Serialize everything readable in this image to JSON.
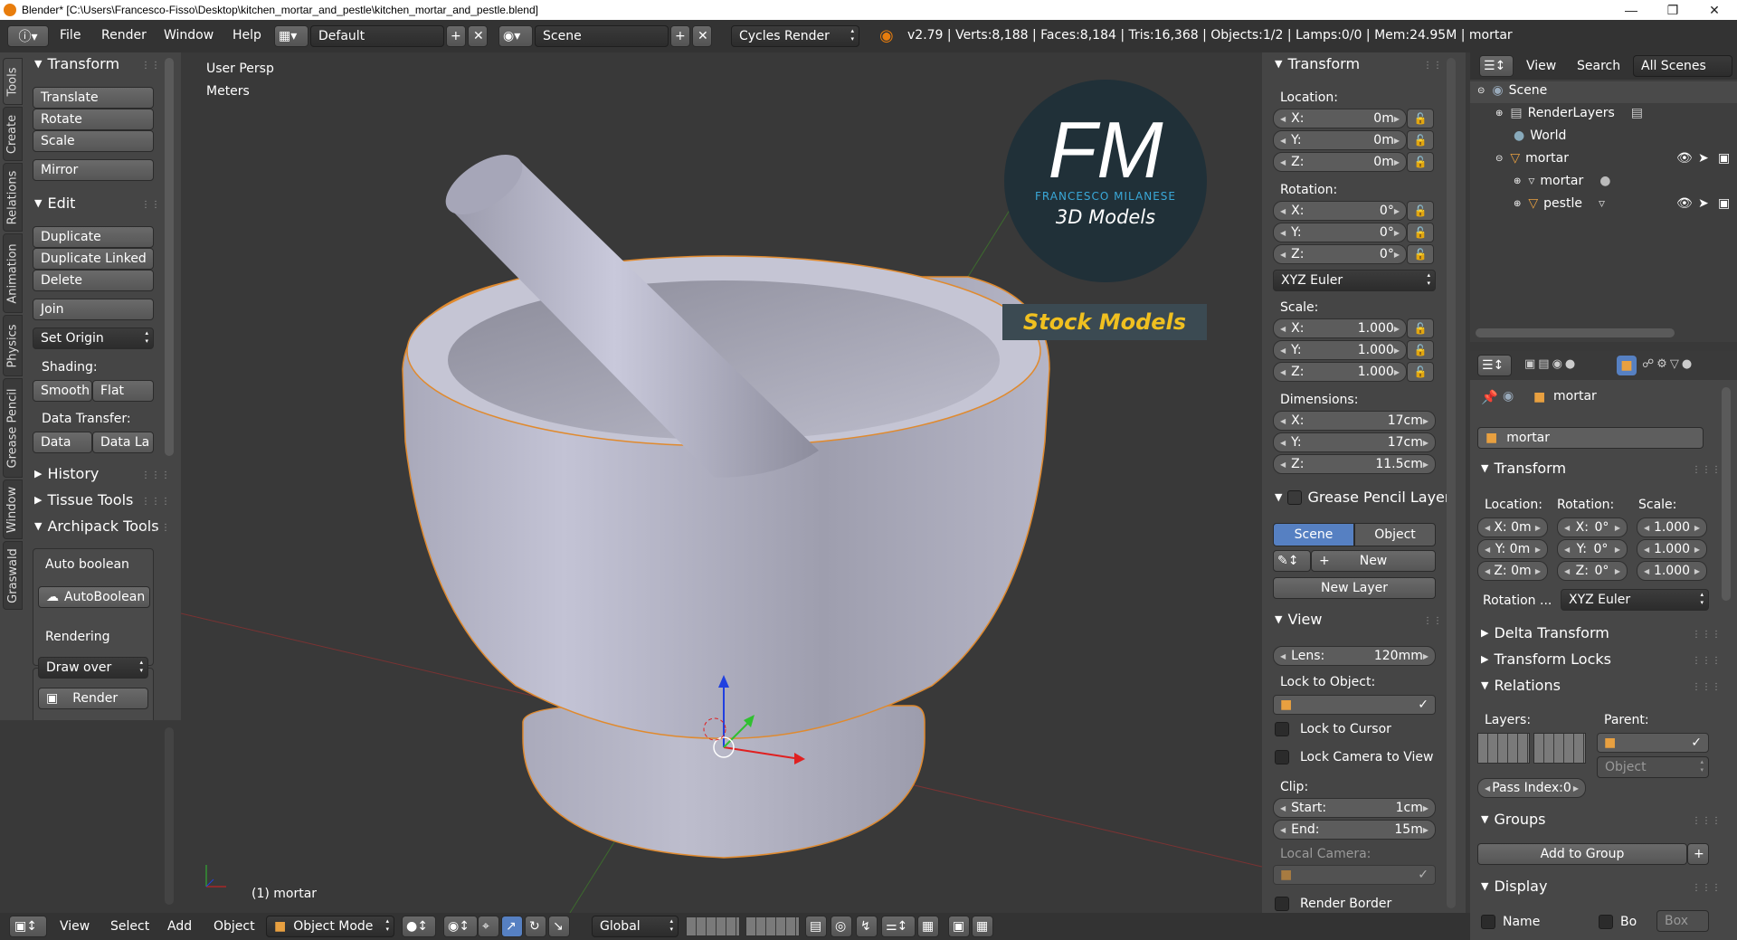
{
  "titlebar": {
    "text": "Blender* [C:\\Users\\Francesco-Fisso\\Desktop\\kitchen_mortar_and_pestle\\kitchen_mortar_and_pestle.blend]"
  },
  "infobar": {
    "menus": [
      "File",
      "Render",
      "Window",
      "Help"
    ],
    "screen_layout": "Default",
    "scene": "Scene",
    "render_engine": "Cycles Render",
    "stats": "v2.79 | Verts:8,188 | Faces:8,184 | Tris:16,368 | Objects:1/2 | Lamps:0/0 | Mem:24.95M | mortar"
  },
  "vtabs": [
    "Tools",
    "Create",
    "Relations",
    "Animation",
    "Physics",
    "Grease Pencil",
    "Window",
    "Graswald"
  ],
  "toolshelf": {
    "transform_header": "Transform",
    "translate": "Translate",
    "rotate": "Rotate",
    "scale": "Scale",
    "mirror": "Mirror",
    "edit_header": "Edit",
    "duplicate": "Duplicate",
    "duplicate_linked": "Duplicate Linked",
    "delete": "Delete",
    "join": "Join",
    "set_origin": "Set Origin",
    "shading_label": "Shading:",
    "smooth": "Smooth",
    "flat": "Flat",
    "data_transfer_label": "Data Transfer:",
    "data": "Data",
    "data_la": "Data La",
    "history": "History",
    "tissue_tools": "Tissue Tools",
    "archipack_tools": "Archipack Tools",
    "auto_boolean_label": "Auto boolean",
    "auto_boolean_btn": "AutoBoolean",
    "rendering_label": "Rendering",
    "draw_over": "Draw over",
    "render_btn": "Render"
  },
  "viewport": {
    "view_name": "User Persp",
    "units": "Meters",
    "object_label": "(1) mortar",
    "watermark": {
      "letters": "FM",
      "name": "FRANCESCO MILANESE",
      "sub": "3D Models",
      "stock": "Stock Models"
    }
  },
  "npanel": {
    "transform_header": "Transform",
    "location_label": "Location:",
    "location": [
      {
        "axis": "X:",
        "value": "0m"
      },
      {
        "axis": "Y:",
        "value": "0m"
      },
      {
        "axis": "Z:",
        "value": "0m"
      }
    ],
    "rotation_label": "Rotation:",
    "rotation": [
      {
        "axis": "X:",
        "value": "0°"
      },
      {
        "axis": "Y:",
        "value": "0°"
      },
      {
        "axis": "Z:",
        "value": "0°"
      }
    ],
    "rotation_mode": "XYZ Euler",
    "scale_label": "Scale:",
    "scale": [
      {
        "axis": "X:",
        "value": "1.000"
      },
      {
        "axis": "Y:",
        "value": "1.000"
      },
      {
        "axis": "Z:",
        "value": "1.000"
      }
    ],
    "dimensions_label": "Dimensions:",
    "dimensions": [
      {
        "axis": "X:",
        "value": "17cm"
      },
      {
        "axis": "Y:",
        "value": "17cm"
      },
      {
        "axis": "Z:",
        "value": "11.5cm"
      }
    ],
    "gp_header": "Grease Pencil Layer",
    "gp_scene": "Scene",
    "gp_object": "Object",
    "gp_new": "New",
    "gp_new_layer": "New Layer",
    "view_header": "View",
    "lens_label": "Lens:",
    "lens_value": "120mm",
    "lock_to_object": "Lock to Object:",
    "lock_to_cursor": "Lock to Cursor",
    "lock_camera": "Lock Camera to View",
    "clip_label": "Clip:",
    "clip_start_label": "Start:",
    "clip_start": "1cm",
    "clip_end_label": "End:",
    "clip_end": "15m",
    "local_camera": "Local Camera:",
    "render_border": "Render Border"
  },
  "outliner": {
    "view": "View",
    "search": "Search",
    "all_scenes": "All Scenes",
    "items": [
      "Scene",
      "RenderLayers",
      "World",
      "mortar",
      "mortar",
      "pestle"
    ]
  },
  "properties": {
    "breadcrumb": "mortar",
    "object_name": "mortar",
    "transform_header": "Transform",
    "location_label": "Location:",
    "rotation_label": "Rotation:",
    "scale_label": "Scale:",
    "loc": [
      "X: 0m",
      "Y: 0m",
      "Z: 0m"
    ],
    "rot_axes": [
      "X:",
      "Y:",
      "Z:"
    ],
    "rot_values": [
      "0°",
      "0°",
      "0°"
    ],
    "scl": [
      "1.000",
      "1.000",
      "1.000"
    ],
    "rotation_mode_label": "Rotation ...",
    "rotation_mode": "XYZ Euler",
    "delta_transform": "Delta Transform",
    "transform_locks": "Transform Locks",
    "relations": "Relations",
    "layers_label": "Layers:",
    "parent_label": "Parent:",
    "parent_type": "Object",
    "pass_index": "Pass Index:0",
    "groups": "Groups",
    "add_to_group": "Add to Group",
    "display": "Display",
    "name_chk": "Name",
    "bo_chk": "Bo",
    "box": "Box"
  },
  "bottombar": {
    "view": "View",
    "select": "Select",
    "add": "Add",
    "object": "Object",
    "mode": "Object Mode",
    "orientation": "Global"
  }
}
